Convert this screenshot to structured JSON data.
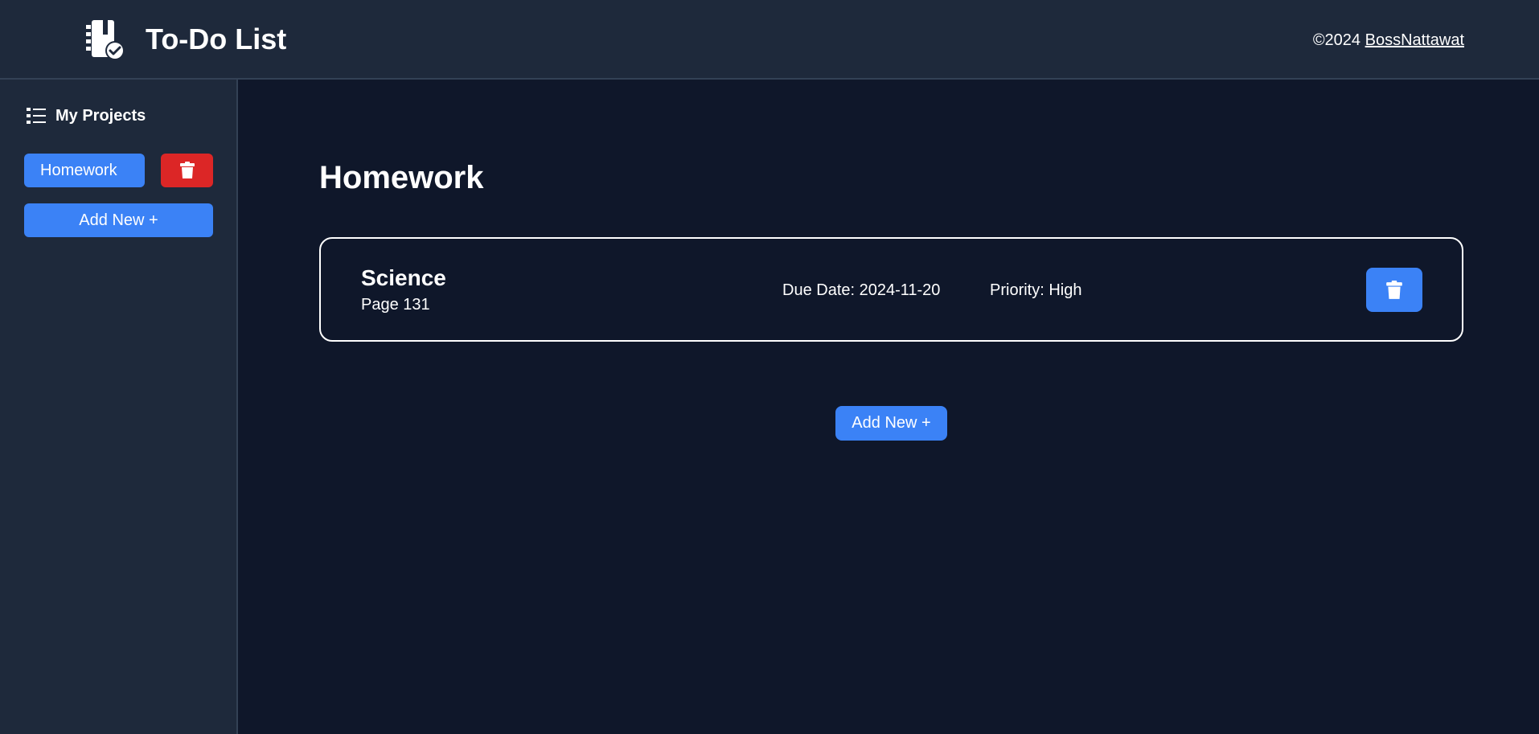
{
  "header": {
    "logo_icon": "notebook-check-icon",
    "title": "To-Do List",
    "copyright_prefix": "©2024 ",
    "author_link": "BossNattawat"
  },
  "sidebar": {
    "icon": "list-icon",
    "title": "My Projects",
    "projects": [
      {
        "label": "Homework",
        "delete_icon": "trash-icon"
      }
    ],
    "add_label": "Add New +"
  },
  "main": {
    "project_title": "Homework",
    "tasks": [
      {
        "name": "Science",
        "description": "Page 131",
        "due": "Due Date: 2024-11-20",
        "priority": "Priority: High",
        "delete_icon": "trash-icon"
      }
    ],
    "add_label": "Add New +"
  },
  "colors": {
    "background": "#0f172a",
    "panel": "#1e293b",
    "accent": "#3b82f6",
    "danger": "#dc2626"
  }
}
